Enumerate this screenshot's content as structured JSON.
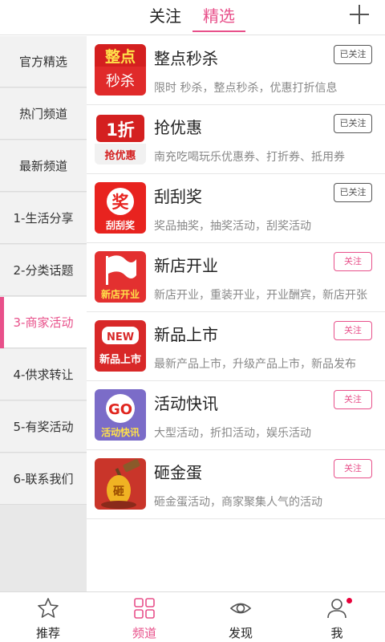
{
  "header": {
    "tabs": [
      {
        "label": "关注",
        "active": false
      },
      {
        "label": "精选",
        "active": true
      }
    ],
    "add_icon": "plus-icon",
    "accent_color": "#e8508a"
  },
  "sidebar": {
    "items": [
      {
        "label": "官方精选",
        "active": false
      },
      {
        "label": "热门频道",
        "active": false
      },
      {
        "label": "最新频道",
        "active": false
      },
      {
        "label": "1-生活分享",
        "active": false
      },
      {
        "label": "2-分类话题",
        "active": false
      },
      {
        "label": "3-商家活动",
        "active": true
      },
      {
        "label": "4-供求转让",
        "active": false
      },
      {
        "label": "5-有奖活动",
        "active": false
      },
      {
        "label": "6-联系我们",
        "active": false
      }
    ]
  },
  "channels": [
    {
      "title": "整点秒杀",
      "desc": "限时 秒杀，整点秒杀，优惠打折信息",
      "follow": "已关注",
      "followed": true,
      "thumb": {
        "line1": "整点",
        "line2": "秒杀",
        "bg": "#e02a2a"
      }
    },
    {
      "title": "抢优惠",
      "desc": "南充吃喝玩乐优惠券、打折券、抵用券",
      "follow": "已关注",
      "followed": true,
      "thumb": {
        "line1": "1折",
        "line2": "抢优惠",
        "bg": "#d42020"
      }
    },
    {
      "title": "刮刮奖",
      "desc": "奖品抽奖，抽奖活动，刮奖活动",
      "follow": "已关注",
      "followed": true,
      "thumb": {
        "line1": "奖",
        "line2": "刮刮奖",
        "bg": "#e8231f"
      }
    },
    {
      "title": "新店开业",
      "desc": "新店开业，重装开业，开业酬宾，新店开张",
      "follow": "关注",
      "followed": false,
      "thumb": {
        "line1": "",
        "line2": "新店开业",
        "bg": "#e33030"
      }
    },
    {
      "title": "新品上市",
      "desc": "最新产品上市，升级产品上市，新品发布",
      "follow": "关注",
      "followed": false,
      "thumb": {
        "line1": "NEW",
        "line2": "新品上市",
        "bg": "#d82828"
      }
    },
    {
      "title": "活动快讯",
      "desc": "大型活动，折扣活动，娱乐活动",
      "follow": "关注",
      "followed": false,
      "thumb": {
        "line1": "GO",
        "line2": "活动快讯",
        "bg": "#7b6cc8"
      }
    },
    {
      "title": "砸金蛋",
      "desc": "砸金蛋活动，商家聚集人气的活动",
      "follow": "关注",
      "followed": false,
      "thumb": {
        "line1": "砸",
        "line2": "",
        "bg": "#c9352a"
      }
    }
  ],
  "bottom_nav": {
    "items": [
      {
        "label": "推荐",
        "icon": "star-icon",
        "active": false
      },
      {
        "label": "频道",
        "icon": "grid-icon",
        "active": true
      },
      {
        "label": "发现",
        "icon": "eye-icon",
        "active": false
      },
      {
        "label": "我",
        "icon": "person-icon",
        "active": false,
        "badge_dot": true
      }
    ]
  }
}
